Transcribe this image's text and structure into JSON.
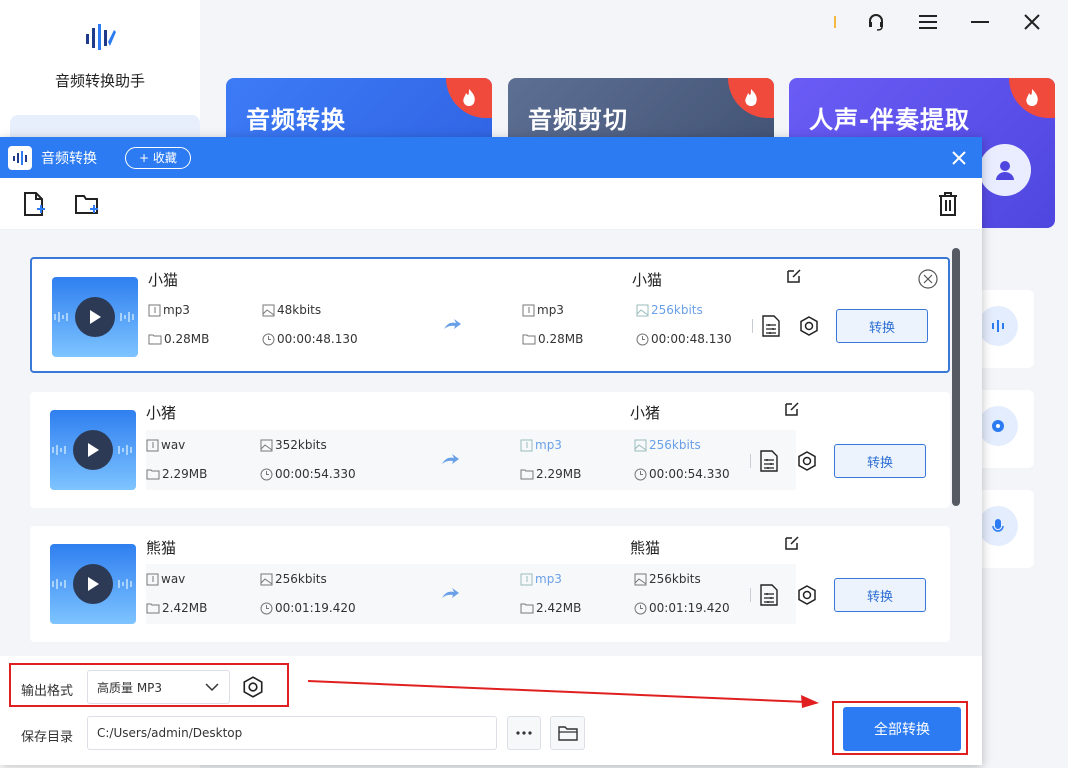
{
  "app": {
    "name": "音频转换助手",
    "cards": [
      {
        "title": "音频转换"
      },
      {
        "title": "音频剪切"
      },
      {
        "title": "人声-伴奏提取"
      }
    ]
  },
  "dialog": {
    "title": "音频转换",
    "favorite_label": "+ 收藏"
  },
  "files": [
    {
      "src_name": "小猫",
      "src_format": "mp3",
      "src_bitrate": "48kbits",
      "src_size": "0.28MB",
      "src_duration": "00:00:48.130",
      "dst_name": "小猫",
      "dst_format": "mp3",
      "dst_bitrate": "256kbits",
      "dst_size": "0.28MB",
      "dst_duration": "00:00:48.130",
      "convert_label": "转换"
    },
    {
      "src_name": "小猪",
      "src_format": "wav",
      "src_bitrate": "352kbits",
      "src_size": "2.29MB",
      "src_duration": "00:00:54.330",
      "dst_name": "小猪",
      "dst_format": "mp3",
      "dst_bitrate": "256kbits",
      "dst_size": "2.29MB",
      "dst_duration": "00:00:54.330",
      "convert_label": "转换"
    },
    {
      "src_name": "熊猫",
      "src_format": "wav",
      "src_bitrate": "256kbits",
      "src_size": "2.42MB",
      "src_duration": "00:01:19.420",
      "dst_name": "熊猫",
      "dst_format": "mp3",
      "dst_bitrate": "256kbits",
      "dst_size": "2.42MB",
      "dst_duration": "00:01:19.420",
      "convert_label": "转换"
    }
  ],
  "bottom": {
    "format_label": "输出格式",
    "format_value": "高质量 MP3",
    "dir_label": "保存目录",
    "dir_value": "C:/Users/admin/Desktop",
    "convert_all_label": "全部转换"
  },
  "colors": {
    "primary": "#2c7bf2",
    "highlight": "#e02020"
  }
}
